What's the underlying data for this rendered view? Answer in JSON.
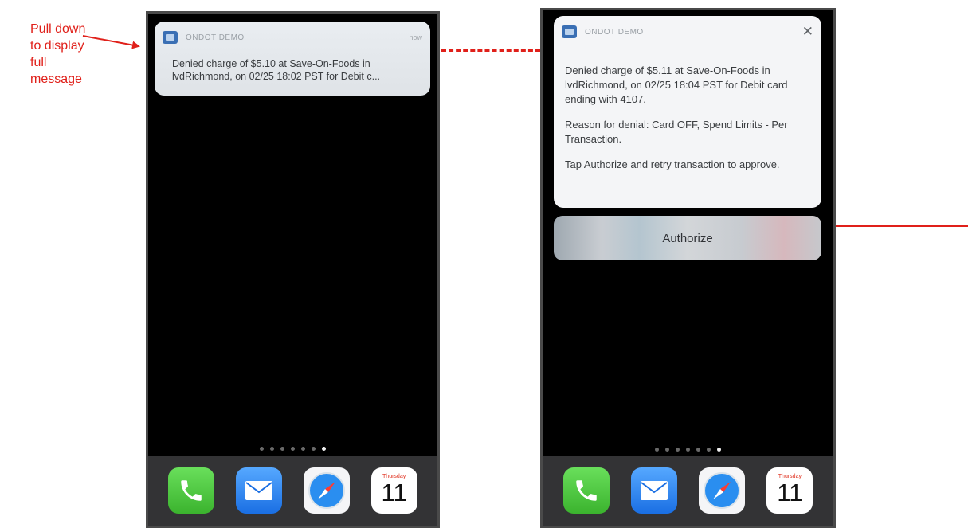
{
  "annotation": {
    "lines": [
      "Pull down",
      "to display",
      "full",
      "message"
    ]
  },
  "left_phone": {
    "app_name": "ONDOT DEMO",
    "time_label": "now",
    "message_lines": [
      "Denied charge of $5.10 at Save-On-Foods in",
      "lvdRichmond,  on 02/25 18:02 PST for Debit c..."
    ],
    "page_dot_count": 7,
    "active_page_dot": 7,
    "calendar": {
      "weekday": "Thursday",
      "date": "11"
    }
  },
  "right_phone": {
    "app_name": "ONDOT DEMO",
    "close_glyph": "✕",
    "paragraphs": [
      "Denied charge of $5.11 at Save-On-Foods in lvdRichmond,  on 02/25 18:04 PST for Debit card ending with 4107.",
      "Reason for denial: Card OFF, Spend Limits - Per Transaction.",
      "Tap Authorize and retry transaction to approve."
    ],
    "authorize_label": "Authorize",
    "page_dot_count": 7,
    "active_page_dot": 7,
    "calendar": {
      "weekday": "Thursday",
      "date": "11"
    }
  },
  "colors": {
    "annotation_red": "#e0201a",
    "phone_background": "#000000",
    "dock_background": "#333335"
  },
  "icons": [
    "message-icon",
    "phone-icon",
    "mail-icon",
    "safari-icon",
    "calendar-icon",
    "close-icon",
    "arrow-icon"
  ]
}
